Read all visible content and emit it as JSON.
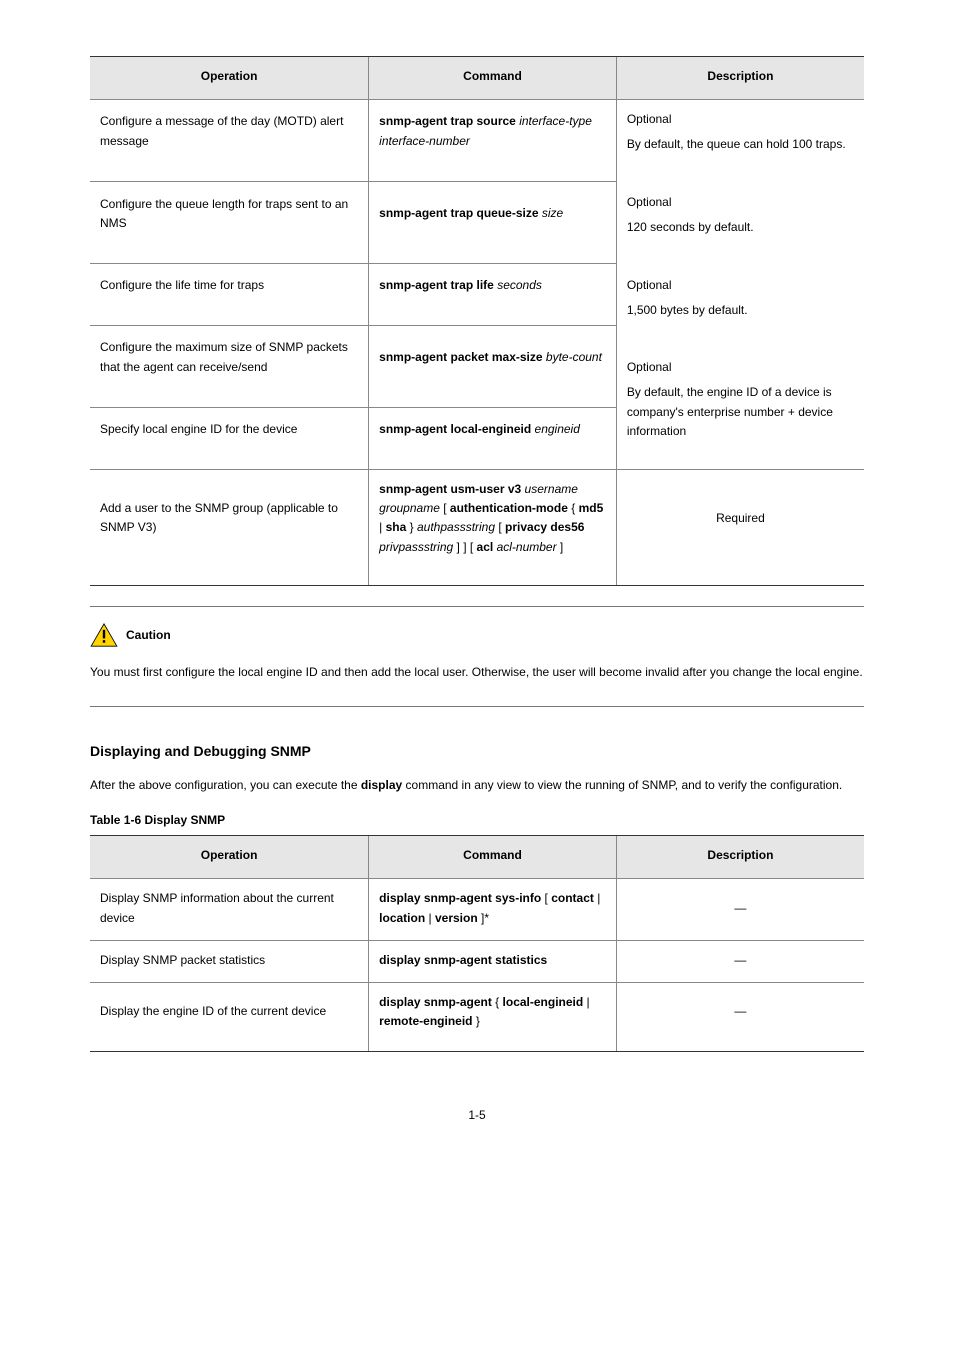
{
  "table1": {
    "headers": [
      "Operation",
      "Command",
      "Description"
    ],
    "rows": [
      {
        "op": "Configure a message of the day (MOTD) alert message",
        "cmd_prefix": "snmp-agent trap source",
        "cmd_arg": "interface-type interface-number",
        "desc": ""
      },
      {
        "op": "Configure the queue length for traps sent to an NMS",
        "cmd_prefix": "snmp-agent trap queue-size",
        "cmd_arg": "size",
        "desc": "Optional\nBy default, the queue can hold 100 traps."
      },
      {
        "op": "Configure the life time for traps",
        "cmd_prefix": "snmp-agent trap life",
        "cmd_arg": "seconds",
        "desc": "Optional\n120 seconds by default."
      },
      {
        "op": "Configure the maximum size of SNMP packets that the agent can receive/send",
        "cmd_prefix": "snmp-agent packet max-size",
        "cmd_arg": "byte-count",
        "desc": "Optional\n1,500 bytes by default."
      },
      {
        "op": "Specify local engine ID for the device",
        "cmd_prefix": "snmp-agent local-engineid",
        "cmd_arg": "engineid",
        "desc": "Optional\nBy default, the engine ID of a device is company's enterprise number + device information"
      },
      {
        "op": "Add a user to the SNMP group (applicable to SNMP V3)",
        "cmd_html": "<b>snmp-agent usm-user v3</b> <i>username groupname</i> [ <b>authentication-mode</b> { <b>md5</b> | <b>sha</b> } <i>authpassstring</i> [ <b>privacy des56</b> <i>privpassstring</i> ] ] [ <b>acl</b> <i>acl-number</i> ]",
        "desc": "Required"
      }
    ]
  },
  "caution": {
    "title": "Caution",
    "text": "You must first configure the local engine ID and then add the local user. Otherwise, the user will become invalid after you change the local engine."
  },
  "section": {
    "title": "Displaying and Debugging SNMP",
    "para": [
      "After the above configuration, you can execute the ",
      " command in any view to view the running of SNMP, and to verify the configuration."
    ],
    "cmd": "display",
    "table_caption": "Table 1-6 Display SNMP"
  },
  "table2": {
    "headers": [
      "Operation",
      "Command",
      "Description"
    ],
    "rows": [
      {
        "op": "Display SNMP information about the current device",
        "cmd": "display snmp-agent sys-info",
        "opts": "[ contact | location | version ]*",
        "desc": "—"
      },
      {
        "op": "Display SNMP packet statistics",
        "cmd": "display snmp-agent statistics",
        "opts": "",
        "desc": "—"
      },
      {
        "op": "Display the engine ID of the current device",
        "cmd": "display snmp-agent",
        "opts": "{ local-engineid | remote-engineid }",
        "desc": "—"
      }
    ]
  },
  "pagenum": "1-5"
}
